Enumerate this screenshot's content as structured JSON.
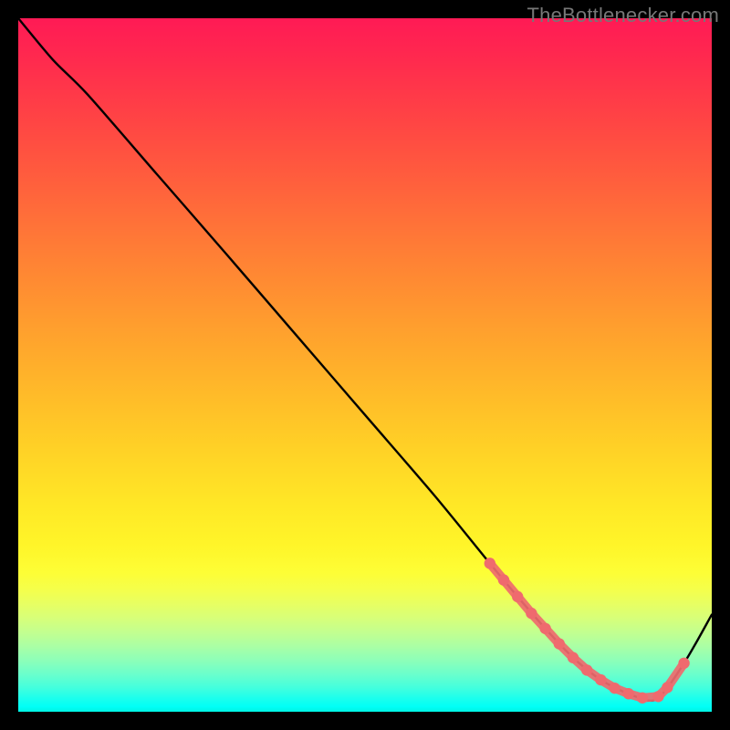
{
  "attribution": "TheBottlenecker.com",
  "chart_data": {
    "type": "line",
    "title": "",
    "xlabel": "",
    "ylabel": "",
    "xlim": [
      0,
      100
    ],
    "ylim": [
      0,
      100
    ],
    "series": [
      {
        "name": "curve",
        "color": "#000000",
        "x": [
          0,
          5,
          10,
          20,
          30,
          40,
          50,
          60,
          68,
          72,
          76,
          80,
          84,
          88,
          92,
          96,
          100
        ],
        "y": [
          100,
          94,
          89,
          77.5,
          66,
          54.4,
          42.8,
          31.2,
          21.4,
          16.6,
          12,
          7.8,
          4.6,
          2.6,
          1.8,
          7.0,
          14.0
        ]
      },
      {
        "name": "highlight-dots",
        "color": "#ef6a6e",
        "type": "scatter",
        "x": [
          68.0,
          70.0,
          72.0,
          74.0,
          76.0,
          78.0,
          80.0,
          82.0,
          84.0,
          86.0,
          88.0,
          90.0,
          92.3,
          93.6,
          96.0
        ],
        "y": [
          21.4,
          19.0,
          16.6,
          14.2,
          12.0,
          9.8,
          7.8,
          6.0,
          4.6,
          3.4,
          2.6,
          2.0,
          2.2,
          3.5,
          7.0
        ]
      }
    ],
    "gradient_stops": [
      {
        "pos": 0.0,
        "color": "#ff1a55"
      },
      {
        "pos": 0.5,
        "color": "#ffc027"
      },
      {
        "pos": 0.8,
        "color": "#fdfe36"
      },
      {
        "pos": 0.93,
        "color": "#6cffcb"
      },
      {
        "pos": 1.0,
        "color": "#00f3e2"
      }
    ]
  }
}
